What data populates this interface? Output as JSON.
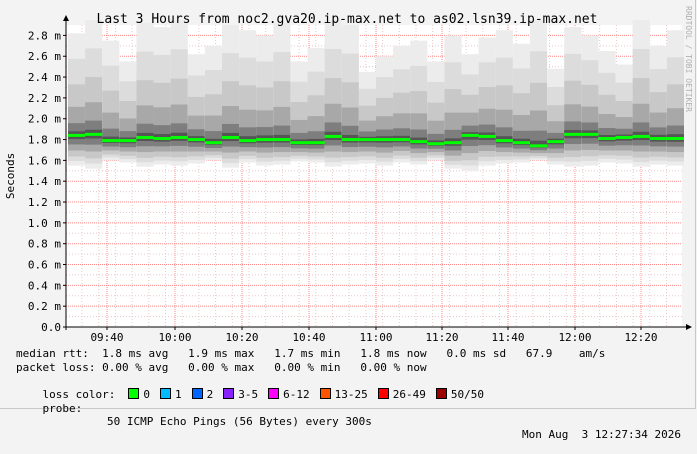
{
  "chart_data": {
    "type": "area",
    "title": "Last 3 Hours from noc2.gva20.ip-max.net to as02.lsn39.ip-max.net",
    "ylabel": "Seconds",
    "ylim": [
      0,
      2.9
    ],
    "yticks": [
      {
        "v": 0.0,
        "label": "0.0"
      },
      {
        "v": 0.2,
        "label": "0.2 m"
      },
      {
        "v": 0.4,
        "label": "0.4 m"
      },
      {
        "v": 0.6,
        "label": "0.6 m"
      },
      {
        "v": 0.8,
        "label": "0.8 m"
      },
      {
        "v": 1.0,
        "label": "1.0 m"
      },
      {
        "v": 1.2,
        "label": "1.2 m"
      },
      {
        "v": 1.4,
        "label": "1.4 m"
      },
      {
        "v": 1.6,
        "label": "1.6 m"
      },
      {
        "v": 1.8,
        "label": "1.8 m"
      },
      {
        "v": 2.0,
        "label": "2.0 m"
      },
      {
        "v": 2.2,
        "label": "2.2 m"
      },
      {
        "v": 2.4,
        "label": "2.4 m"
      },
      {
        "v": 2.6,
        "label": "2.6 m"
      },
      {
        "v": 2.8,
        "label": "2.8 m"
      }
    ],
    "xticks": [
      "09:40",
      "10:00",
      "10:20",
      "10:40",
      "11:00",
      "11:20",
      "11:40",
      "12:00",
      "12:20"
    ],
    "median": [
      1.84,
      1.85,
      1.79,
      1.79,
      1.82,
      1.81,
      1.82,
      1.8,
      1.77,
      1.82,
      1.79,
      1.8,
      1.8,
      1.77,
      1.77,
      1.83,
      1.8,
      1.8,
      1.8,
      1.8,
      1.78,
      1.76,
      1.77,
      1.84,
      1.83,
      1.79,
      1.77,
      1.74,
      1.78,
      1.85,
      1.85,
      1.81,
      1.82,
      1.83,
      1.81,
      1.81
    ],
    "smoke_top": [
      2.82,
      2.95,
      2.75,
      2.55,
      2.92,
      2.88,
      2.95,
      2.62,
      2.7,
      2.9,
      2.85,
      2.8,
      2.92,
      2.55,
      2.68,
      2.95,
      2.9,
      2.45,
      2.6,
      2.7,
      2.75,
      2.55,
      2.8,
      2.62,
      2.78,
      2.85,
      2.72,
      2.95,
      2.48,
      2.88,
      2.8,
      2.65,
      2.52,
      2.95,
      2.7,
      2.85
    ],
    "smoke_bottom": [
      1.55,
      1.52,
      1.6,
      1.58,
      1.54,
      1.56,
      1.55,
      1.57,
      1.6,
      1.53,
      1.58,
      1.55,
      1.56,
      1.59,
      1.58,
      1.54,
      1.56,
      1.57,
      1.55,
      1.58,
      1.56,
      1.6,
      1.52,
      1.5,
      1.55,
      1.57,
      1.58,
      1.6,
      1.56,
      1.54,
      1.55,
      1.58,
      1.57,
      1.54,
      1.56,
      1.55
    ],
    "loss": [
      0,
      0,
      0,
      0,
      0,
      0,
      0,
      0,
      0,
      0,
      0,
      0,
      0,
      0,
      0,
      0,
      0,
      0,
      0,
      0,
      0,
      0,
      0,
      0,
      0,
      0,
      0,
      0,
      0,
      0,
      0,
      0,
      0,
      0,
      0,
      0
    ]
  },
  "watermark": "RRDTOOL / TOBI OETIKER",
  "colors": {
    "median": "#00ff00",
    "grid_major": "#ff8888",
    "grid_minor": "#e8c8c8",
    "plot_bg": "#ffffff"
  },
  "stats": {
    "median_rtt": "median rtt:  1.8 ms avg   1.9 ms max   1.7 ms min   1.8 ms now   0.0 ms sd   67.9    am/s",
    "packet_loss": "packet loss: 0.00 % avg   0.00 % max   0.00 % min   0.00 % now"
  },
  "loss_legend": {
    "label": "loss color:",
    "items": [
      {
        "label": "0",
        "color": "#00ff00"
      },
      {
        "label": "1",
        "color": "#00bbff"
      },
      {
        "label": "2",
        "color": "#0066ff"
      },
      {
        "label": "3-5",
        "color": "#8822ff"
      },
      {
        "label": "6-12",
        "color": "#ff00ff"
      },
      {
        "label": "13-25",
        "color": "#ff5500"
      },
      {
        "label": "26-49",
        "color": "#ff0000"
      },
      {
        "label": "50/50",
        "color": "#990000"
      }
    ]
  },
  "probe": {
    "label": "probe:",
    "text": "50 ICMP Echo Pings (56 Bytes) every 300s",
    "timestamp": "Mon Aug  3 12:27:34 2026"
  }
}
